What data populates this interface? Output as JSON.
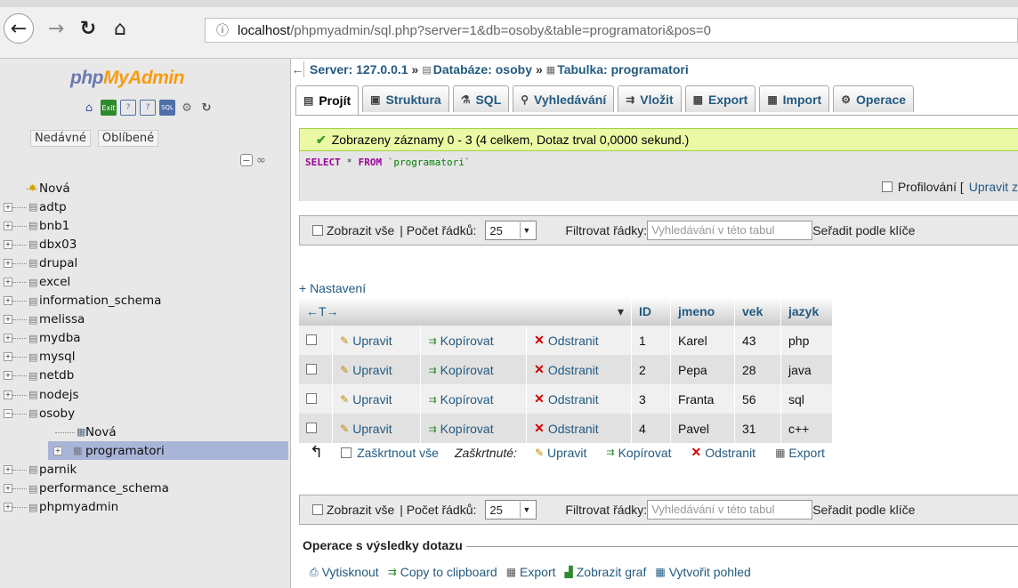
{
  "browser": {
    "url_host": "localhost",
    "url_path": "/phpmyadmin/sql.php?server=1&db=osoby&table=programatori&pos=0"
  },
  "sidebar": {
    "logo_php": "php",
    "logo_my": "My",
    "logo_admin": "Admin",
    "tab_recent": "Nedávné",
    "tab_favorites": "Oblíbené",
    "new_label": "Nová",
    "databases": [
      "adtp",
      "bnb1",
      "dbx03",
      "drupal",
      "excel",
      "information_schema",
      "melissa",
      "mydba",
      "mysql",
      "netdb",
      "nodejs",
      "osoby"
    ],
    "osoby_new": "Nová",
    "osoby_selected_table": "programatori",
    "databases_after": [
      "parnik",
      "performance_schema",
      "phpmyadmin"
    ]
  },
  "breadcrumb": {
    "server": "Server: 127.0.0.1",
    "database": "Databáze: osoby",
    "table": "Tabulka: programatori"
  },
  "tabs": [
    "Projít",
    "Struktura",
    "SQL",
    "Vyhledávání",
    "Vložit",
    "Export",
    "Import",
    "Operace"
  ],
  "message": "Zobrazeny záznamy 0 - 3 (4 celkem, Dotaz trval 0,0000 sekund.)",
  "sql": {
    "select": "SELECT",
    "star": " * ",
    "from": "FROM",
    "table": " `programatori`",
    "profiling_label": "Profilování [",
    "edit_inline": "Upravit z"
  },
  "nav": {
    "show_all": "Zobrazit vše",
    "rows_label": "| Počet řádků:",
    "rows_value": "25",
    "filter_label": "Filtrovat řádky:",
    "filter_placeholder": "Vyhledávání v této tabul",
    "sort_label": "Seřadit podle klíče"
  },
  "settings_link": "+ Nastavení",
  "table": {
    "arrows": "←T→",
    "columns": [
      "ID",
      "jmeno",
      "vek",
      "jazyk"
    ],
    "edit_label": "Upravit",
    "copy_label": "Kopírovat",
    "delete_label": "Odstranit",
    "rows": [
      {
        "id": "1",
        "jmeno": "Karel",
        "vek": "43",
        "jazyk": "php"
      },
      {
        "id": "2",
        "jmeno": "Pepa",
        "vek": "28",
        "jazyk": "java"
      },
      {
        "id": "3",
        "jmeno": "Franta",
        "vek": "56",
        "jazyk": "sql"
      },
      {
        "id": "4",
        "jmeno": "Pavel",
        "vek": "31",
        "jazyk": "c++"
      }
    ]
  },
  "bulk": {
    "check_all": "Zaškrtnout vše",
    "checked_label": "Zaškrtnuté:",
    "edit": "Upravit",
    "copy": "Kopírovat",
    "delete": "Odstranit",
    "export": "Export"
  },
  "operations": {
    "legend": "Operace s výsledky dotazu",
    "print": "Vytisknout",
    "clipboard": "Copy to clipboard",
    "export": "Export",
    "chart": "Zobrazit graf",
    "view": "Vytvořit pohled"
  }
}
